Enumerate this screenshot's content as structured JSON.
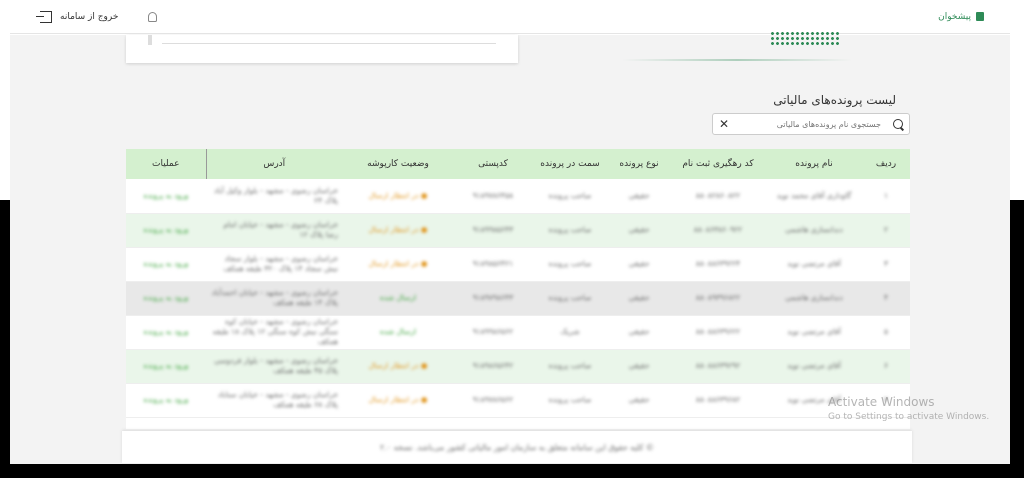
{
  "header": {
    "logout_label": "خروج از سامانه",
    "dashboard_label": "پیشخوان",
    "accent": "#2e8b57"
  },
  "section": {
    "title": "لیست پرونده‌های مالیاتی"
  },
  "search": {
    "placeholder": "جستجوی نام پرونده‌های مالیاتی"
  },
  "table": {
    "columns": [
      "ردیف",
      "نام پرونده",
      "کد رهگیری ثبت نام",
      "نوع پرونده",
      "سمت در پرونده",
      "کدپستی",
      "وضعیت کارپوشه",
      "آدرس",
      "عملیات"
    ],
    "rows": [
      {
        "row": "۱",
        "name": "گاوداری آقای محمد نوید",
        "code": "۸۸۰۸۲۸۶۰۸۲۲",
        "type": "حقیقی",
        "role": "صاحب پرونده",
        "postal": "۹۱۸۹۷۸۶۴۵۸",
        "status": "● در انتظار ارسال",
        "address": "خراسان رضوی - مشهد - بلوار وکیل آباد پلاک ۲۴",
        "ops": "ورود به پرونده",
        "style": "",
        "status_style": "orange"
      },
      {
        "row": "۲",
        "name": "دندانسازی هاشمی",
        "code": "۸۸۰۸۶۳۸۶۰۹۲۲",
        "type": "حقیقی",
        "role": "صاحب پرونده",
        "postal": "۹۱۸۹۹۸۵۶۴۳",
        "status": "● در انتظار ارسال",
        "address": "خراسان رضوی - مشهد - خیابان امام رضا پلاک ۱۲",
        "ops": "ورود به پرونده",
        "style": "green",
        "status_style": "orange"
      },
      {
        "row": "۳",
        "name": "آقای مرتضی نوید",
        "code": "۸۸۰۸۸۶۳۹۲۲۴",
        "type": "حقیقی",
        "role": "صاحب پرونده",
        "postal": "۹۱۸۹۸۵۶۴۲۱",
        "status": "● در انتظار ارسال",
        "address": "خراسان رضوی - مشهد - بلوار سجاد نبش سجاد ۱۴ پلاک ۳۲۰ طبقه همکف",
        "ops": "ورود به پرونده",
        "style": "",
        "status_style": "orange"
      },
      {
        "row": "۴",
        "name": "دندانسازی هاشمی",
        "code": "۸۸۰۸۹۳۹۶۸۲۲",
        "type": "حقیقی",
        "role": "صاحب پرونده",
        "postal": "۹۱۸۹۷۹۸۶۴۳",
        "status": "ارسال شده",
        "address": "خراسان رضوی - مشهد - خیابان احمدآباد پلاک ۱۴ طبقه همکف",
        "ops": "ورود به پرونده",
        "style": "gray",
        "status_style": "green"
      },
      {
        "row": "۵",
        "name": "آقای مرتضی نوید",
        "code": "۸۸۰۸۸۶۳۹۶۲۲",
        "type": "حقیقی",
        "role": "شریک",
        "postal": "۹۱۸۹۹۸۶۵۶۲",
        "status": "ارسال شده",
        "address": "خراسان رضوی - مشهد - خیابان کوه سنگی نبش کوه سنگی ۱۲ پلاک ۱۸ طبقه همکف",
        "ops": "ورود به پرونده",
        "style": "",
        "status_style": "green"
      },
      {
        "row": "۶",
        "name": "آقای مرتضی نوید",
        "code": "۸۸۰۸۸۶۳۹۲۹۲",
        "type": "حقیقی",
        "role": "صاحب پرونده",
        "postal": "۹۱۸۹۸۶۵۶۴۲",
        "status": "● در انتظار ارسال",
        "address": "خراسان رضوی - مشهد - بلوار فردوسی پلاک ۴۵ طبقه همکف",
        "ops": "ورود به پرونده",
        "style": "green",
        "status_style": "orange"
      },
      {
        "row": "۷",
        "name": "آقای مرتضی نوید",
        "code": "۸۸۰۸۸۶۳۹۶۸۲",
        "type": "حقیقی",
        "role": "صاحب پرونده",
        "postal": "۹۱۸۹۷۸۶۵۶۲",
        "status": "● در انتظار ارسال",
        "address": "خراسان رضوی - مشهد - خیابان سناباد پلاک ۶۸ طبقه همکف",
        "ops": "ورود به پرونده",
        "style": "",
        "status_style": "orange"
      }
    ]
  },
  "footer": {
    "text": "© کلیه حقوق این سامانه متعلق به سازمان امور مالیاتی کشور می‌باشد. نسخه ۲.۰"
  },
  "watermark": {
    "line1": "Activate Windows",
    "line2": "Go to Settings to activate Windows."
  }
}
